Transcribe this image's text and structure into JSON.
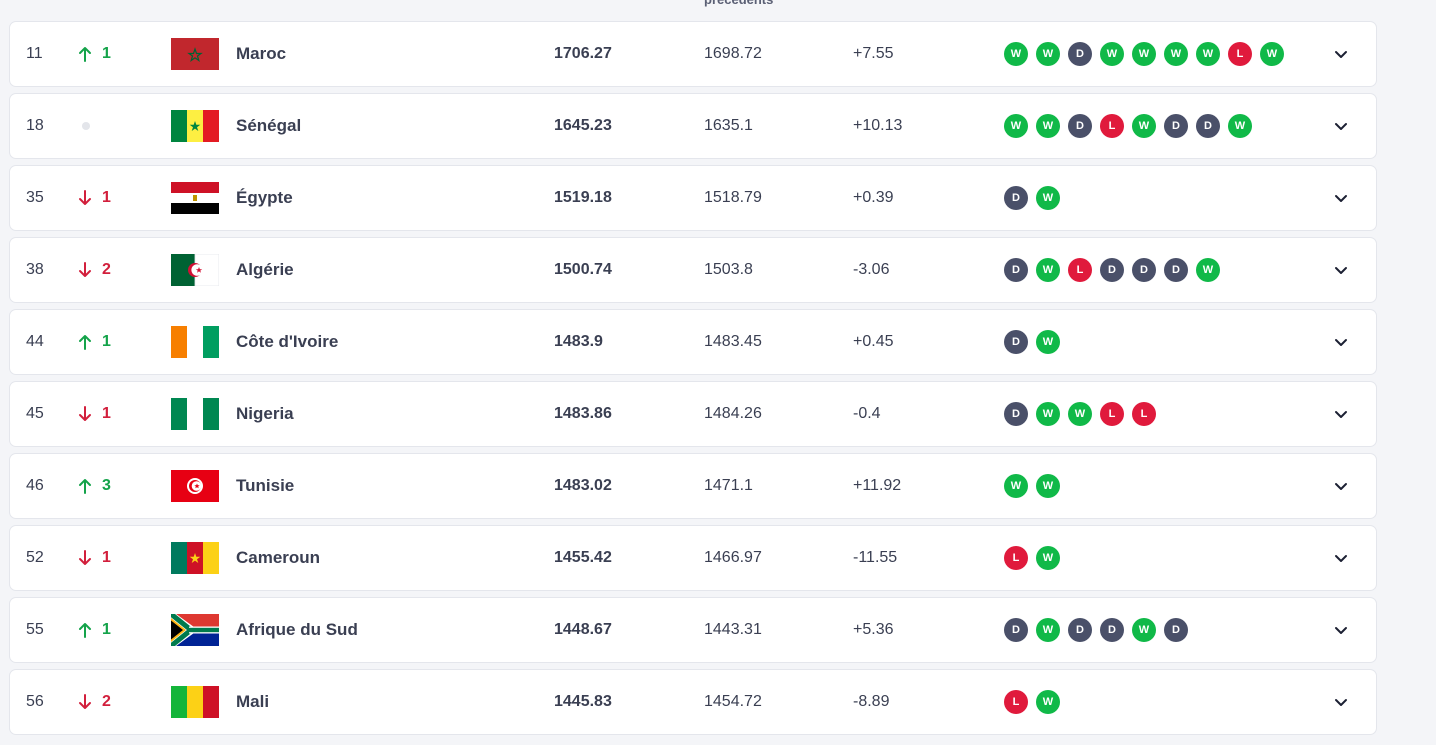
{
  "header_fragment": "precedents",
  "rows": [
    {
      "rank": "11",
      "trend": "up",
      "change": "1",
      "flag": "morocco",
      "name": "Maroc",
      "points": "1706.27",
      "previous": "1698.72",
      "diff": "+7.55",
      "form": [
        "W",
        "W",
        "D",
        "W",
        "W",
        "W",
        "W",
        "L",
        "W"
      ]
    },
    {
      "rank": "18",
      "trend": "same",
      "change": "",
      "flag": "senegal",
      "name": "Sénégal",
      "points": "1645.23",
      "previous": "1635.1",
      "diff": "+10.13",
      "form": [
        "W",
        "W",
        "D",
        "L",
        "W",
        "D",
        "D",
        "W"
      ]
    },
    {
      "rank": "35",
      "trend": "down",
      "change": "1",
      "flag": "egypt",
      "name": "Égypte",
      "points": "1519.18",
      "previous": "1518.79",
      "diff": "+0.39",
      "form": [
        "D",
        "W"
      ]
    },
    {
      "rank": "38",
      "trend": "down",
      "change": "2",
      "flag": "algeria",
      "name": "Algérie",
      "points": "1500.74",
      "previous": "1503.8",
      "diff": "-3.06",
      "form": [
        "D",
        "W",
        "L",
        "D",
        "D",
        "D",
        "W"
      ]
    },
    {
      "rank": "44",
      "trend": "up",
      "change": "1",
      "flag": "ivory-coast",
      "name": "Côte d'Ivoire",
      "points": "1483.9",
      "previous": "1483.45",
      "diff": "+0.45",
      "form": [
        "D",
        "W"
      ]
    },
    {
      "rank": "45",
      "trend": "down",
      "change": "1",
      "flag": "nigeria",
      "name": "Nigeria",
      "points": "1483.86",
      "previous": "1484.26",
      "diff": "-0.4",
      "form": [
        "D",
        "W",
        "W",
        "L",
        "L"
      ]
    },
    {
      "rank": "46",
      "trend": "up",
      "change": "3",
      "flag": "tunisia",
      "name": "Tunisie",
      "points": "1483.02",
      "previous": "1471.1",
      "diff": "+11.92",
      "form": [
        "W",
        "W"
      ]
    },
    {
      "rank": "52",
      "trend": "down",
      "change": "1",
      "flag": "cameroon",
      "name": "Cameroun",
      "points": "1455.42",
      "previous": "1466.97",
      "diff": "-11.55",
      "form": [
        "L",
        "W"
      ]
    },
    {
      "rank": "55",
      "trend": "up",
      "change": "1",
      "flag": "south-africa",
      "name": "Afrique du Sud",
      "points": "1448.67",
      "previous": "1443.31",
      "diff": "+5.36",
      "form": [
        "D",
        "W",
        "D",
        "D",
        "W",
        "D"
      ]
    },
    {
      "rank": "56",
      "trend": "down",
      "change": "2",
      "flag": "mali",
      "name": "Mali",
      "points": "1445.83",
      "previous": "1454.72",
      "diff": "-8.89",
      "form": [
        "L",
        "W"
      ]
    }
  ],
  "colors": {
    "win": "#10b948",
    "draw": "#4a5069",
    "loss": "#e01a3c",
    "up": "#14a34a",
    "down": "#d21f3c"
  }
}
